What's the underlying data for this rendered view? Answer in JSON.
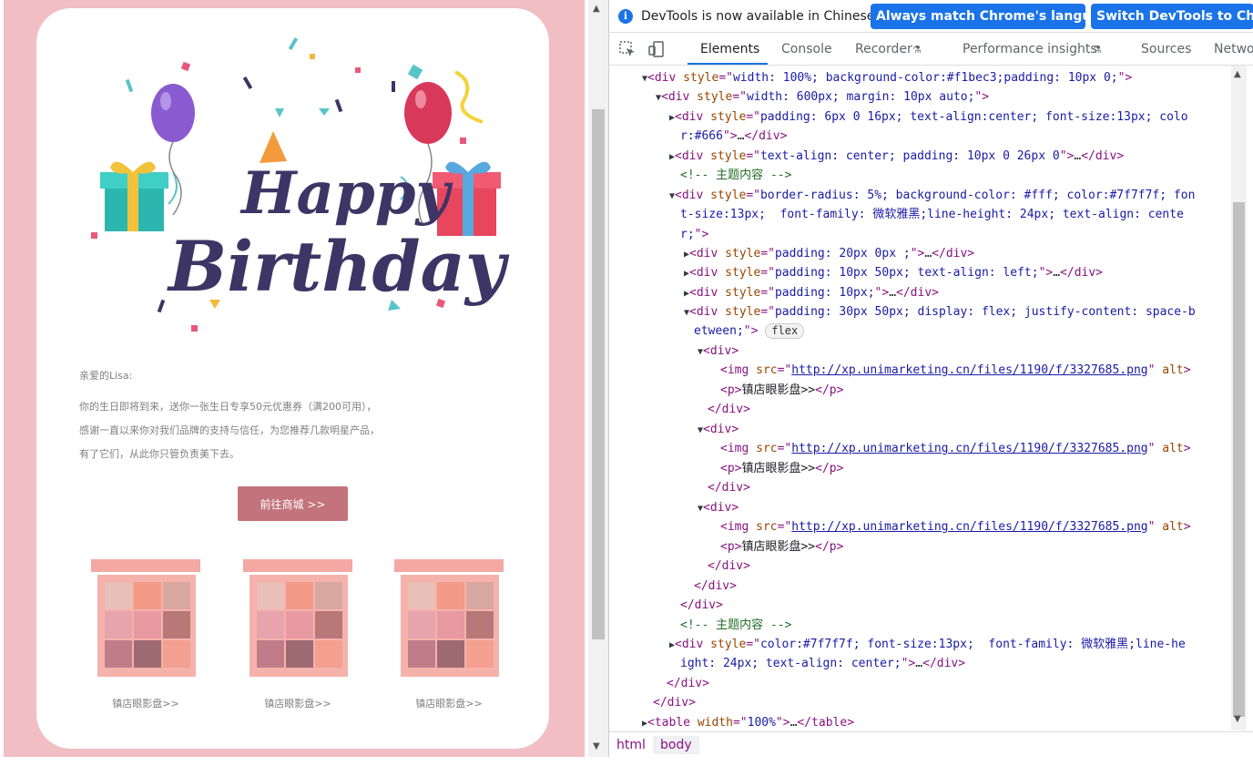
{
  "email": {
    "hero_word1": "Happy",
    "hero_word2": "Birthday",
    "greeting": "亲爱的Lisa:",
    "body_lines": [
      "你的生日即将到来，送你一张生日专享50元优惠券（满200可用），",
      "感谢一直以来你对我们品牌的支持与信任，为您推荐几款明星产品，",
      "有了它们，从此你只管负责美下去。"
    ],
    "cta": "前往商城 >>",
    "products": [
      {
        "caption": "镇店眼影盘>>"
      },
      {
        "caption": "镇店眼影盘>>"
      },
      {
        "caption": "镇店眼影盘>>"
      }
    ],
    "colors": {
      "page_bg": "#f1bec3",
      "button": "#c3737b",
      "text": "#7f7f7f"
    }
  },
  "devtools": {
    "info_message": "DevTools is now available in Chinese!",
    "btn_match": "Always match Chrome's language",
    "btn_switch": "Switch DevTools to Chines",
    "tabs": [
      "Elements",
      "Console",
      "Recorder",
      "Performance insights",
      "Sources",
      "Netwo"
    ],
    "active_tab": "Elements",
    "flex_badge": "flex",
    "crumbs": [
      "html",
      "body"
    ],
    "lines": [
      {
        "i": 0,
        "t": "open",
        "html": "<span class='tri'>▼</span><span class='tag'>&lt;div </span><span class='an'>style</span><span class='tag'>=\"</span><span class='av'>width: 100%; background-color:#f1bec3;padding: 10px 0;</span><span class='tag'>\"&gt;</span>"
      }
    ]
  }
}
